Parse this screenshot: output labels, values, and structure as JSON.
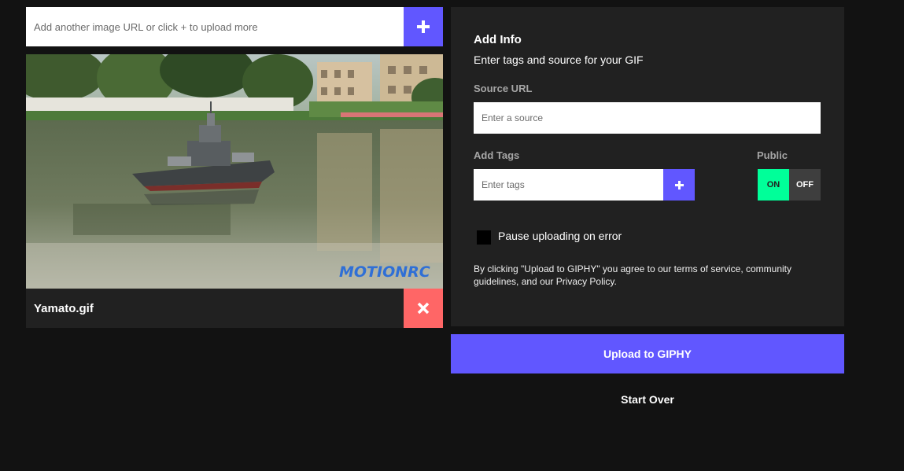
{
  "upload": {
    "url_placeholder": "Add another image URL or click + to upload more",
    "add_icon": "plus-icon"
  },
  "file": {
    "name": "Yamato.gif",
    "watermark": "MOTIONRC",
    "remove_icon": "close-icon"
  },
  "info": {
    "title": "Add Info",
    "subtitle": "Enter tags and source for your GIF",
    "source_label": "Source URL",
    "source_placeholder": "Enter a source",
    "tags_label": "Add Tags",
    "tags_placeholder": "Enter tags",
    "public_label": "Public",
    "toggle_on": "ON",
    "toggle_off": "OFF",
    "pause_label": "Pause uploading on error",
    "terms": "By clicking \"Upload to GIPHY\" you agree to our terms of service, community guidelines, and our Privacy Policy."
  },
  "actions": {
    "upload_label": "Upload to GIPHY",
    "start_over_label": "Start Over"
  },
  "colors": {
    "accent": "#6157ff",
    "toggle_on": "#00ff99",
    "remove": "#ff6666",
    "panel": "#212121",
    "background": "#121212"
  }
}
